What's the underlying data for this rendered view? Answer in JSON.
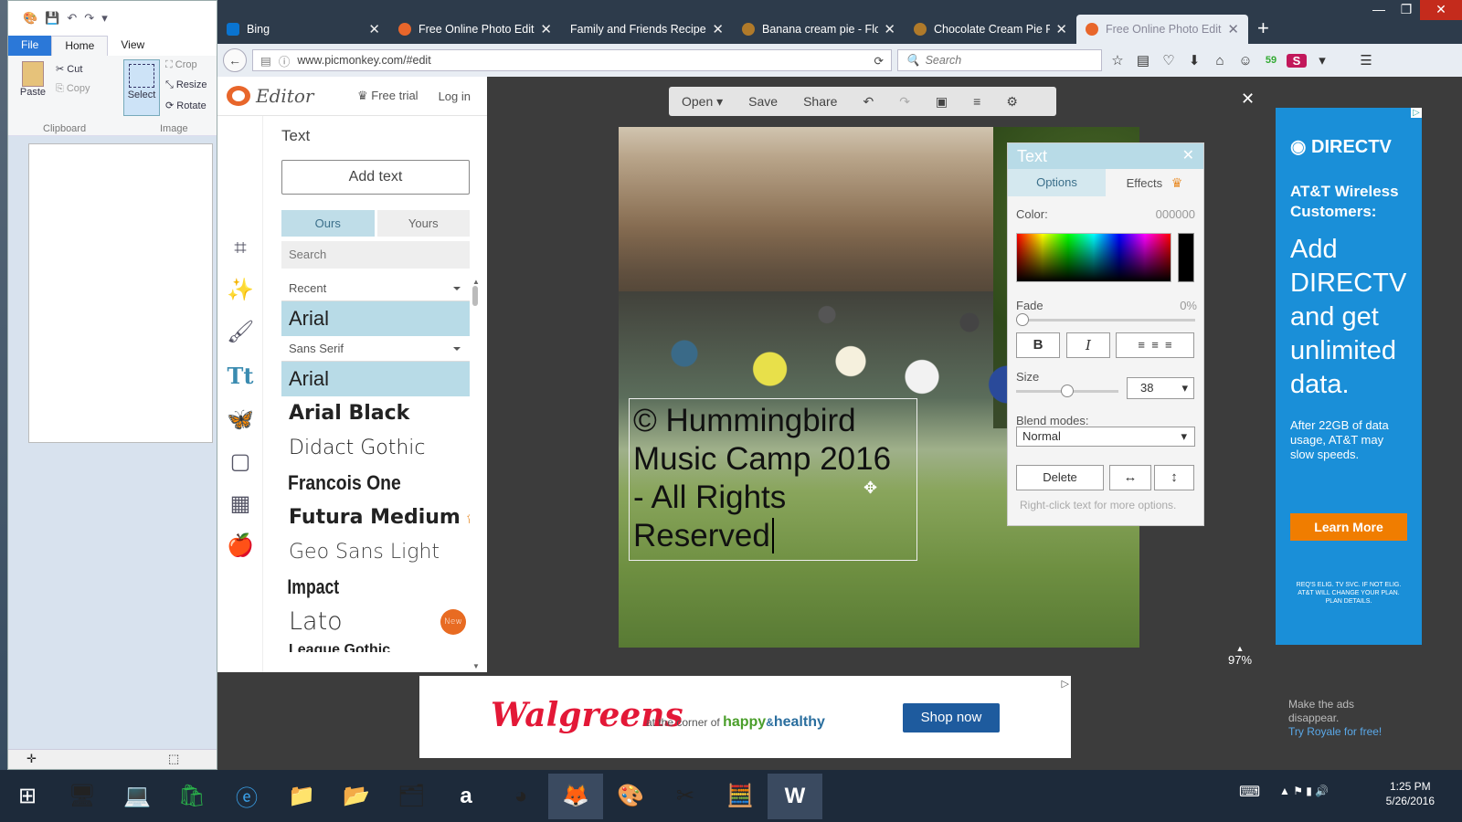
{
  "paint": {
    "tabs": {
      "file": "File",
      "home": "Home",
      "view": "View"
    },
    "clipboard": {
      "paste": "Paste",
      "cut": "Cut",
      "copy": "Copy",
      "group": "Clipboard"
    },
    "image": {
      "select": "Select",
      "crop": "Crop",
      "resize": "Resize",
      "rotate": "Rotate",
      "group": "Image"
    }
  },
  "browser": {
    "tabs": [
      {
        "title": "Bing",
        "favicon_color": "#0a74d1"
      },
      {
        "title": "Free Online Photo Edit...",
        "favicon_color": "#e8662b"
      },
      {
        "title": "Family and Friends Recipes...",
        "favicon_color": ""
      },
      {
        "title": "Banana cream pie - Flo...",
        "favicon_color": "#b07a2a"
      },
      {
        "title": "Chocolate Cream Pie R...",
        "favicon_color": "#b07a2a"
      },
      {
        "title": "Free Online Photo Edit...",
        "favicon_color": "#e8662b",
        "active": true
      }
    ],
    "new_tab": "+",
    "url": "www.picmonkey.com/#edit",
    "search_placeholder": "Search",
    "badge_count": "59"
  },
  "editor": {
    "logo": "Editor",
    "free_trial": "Free trial",
    "log_in": "Log in",
    "panel_title": "Text",
    "add_text": "Add text",
    "tab_ours": "Ours",
    "tab_yours": "Yours",
    "font_search_placeholder": "Search",
    "group_recent": "Recent",
    "group_sans": "Sans Serif",
    "fonts": [
      {
        "name": "Arial",
        "selected": true
      },
      {
        "name": "Arial Black"
      },
      {
        "name": "Didact Gothic"
      },
      {
        "name": "Francois One"
      },
      {
        "name": "Futura Medium",
        "premium": true
      },
      {
        "name": "Geo Sans Light"
      },
      {
        "name": "Impact"
      },
      {
        "name": "Lato",
        "badge": "New"
      },
      {
        "name": "League Gothic"
      }
    ],
    "recent_font": "Arial",
    "toolbar": {
      "open": "Open",
      "save": "Save",
      "share": "Share"
    },
    "canvas_text": [
      "© Hummingbird",
      "Music Camp 2016",
      "- All Rights",
      "Reserved"
    ],
    "zoom": "97%"
  },
  "text_panel": {
    "title": "Text",
    "tab_options": "Options",
    "tab_effects": "Effects",
    "color_label": "Color:",
    "color_value": "000000",
    "fade_label": "Fade",
    "fade_value": "0%",
    "fade_level": 0,
    "bold": "B",
    "italic": "I",
    "size_label": "Size",
    "size_value": "38",
    "blend_label": "Blend modes:",
    "blend_value": "Normal",
    "delete": "Delete",
    "hint": "Right-click text for more options."
  },
  "ads": {
    "right": {
      "brand": "DIRECTV",
      "headline": "AT&T Wireless Customers:",
      "body": "Add DIRECTV and get unlimited data.",
      "fine": "After 22GB of data usage, AT&T may slow speeds.",
      "cta": "Learn More",
      "legal": "REQ'S ELIG. TV SVC. IF NOT ELIG. AT&T WILL CHANGE YOUR PLAN. PLAN DETAILS."
    },
    "bottom": {
      "brand": "Walgreens",
      "tag_a": "at the corner of",
      "tag_b": "happy",
      "tag_c": "&",
      "tag_d": "healthy",
      "cta": "Shop now"
    },
    "royale": {
      "line1": "Make the ads",
      "line2": "disappear.",
      "link": "Try Royale for free!"
    }
  },
  "taskbar": {
    "time": "1:25 PM",
    "date": "5/26/2016"
  }
}
